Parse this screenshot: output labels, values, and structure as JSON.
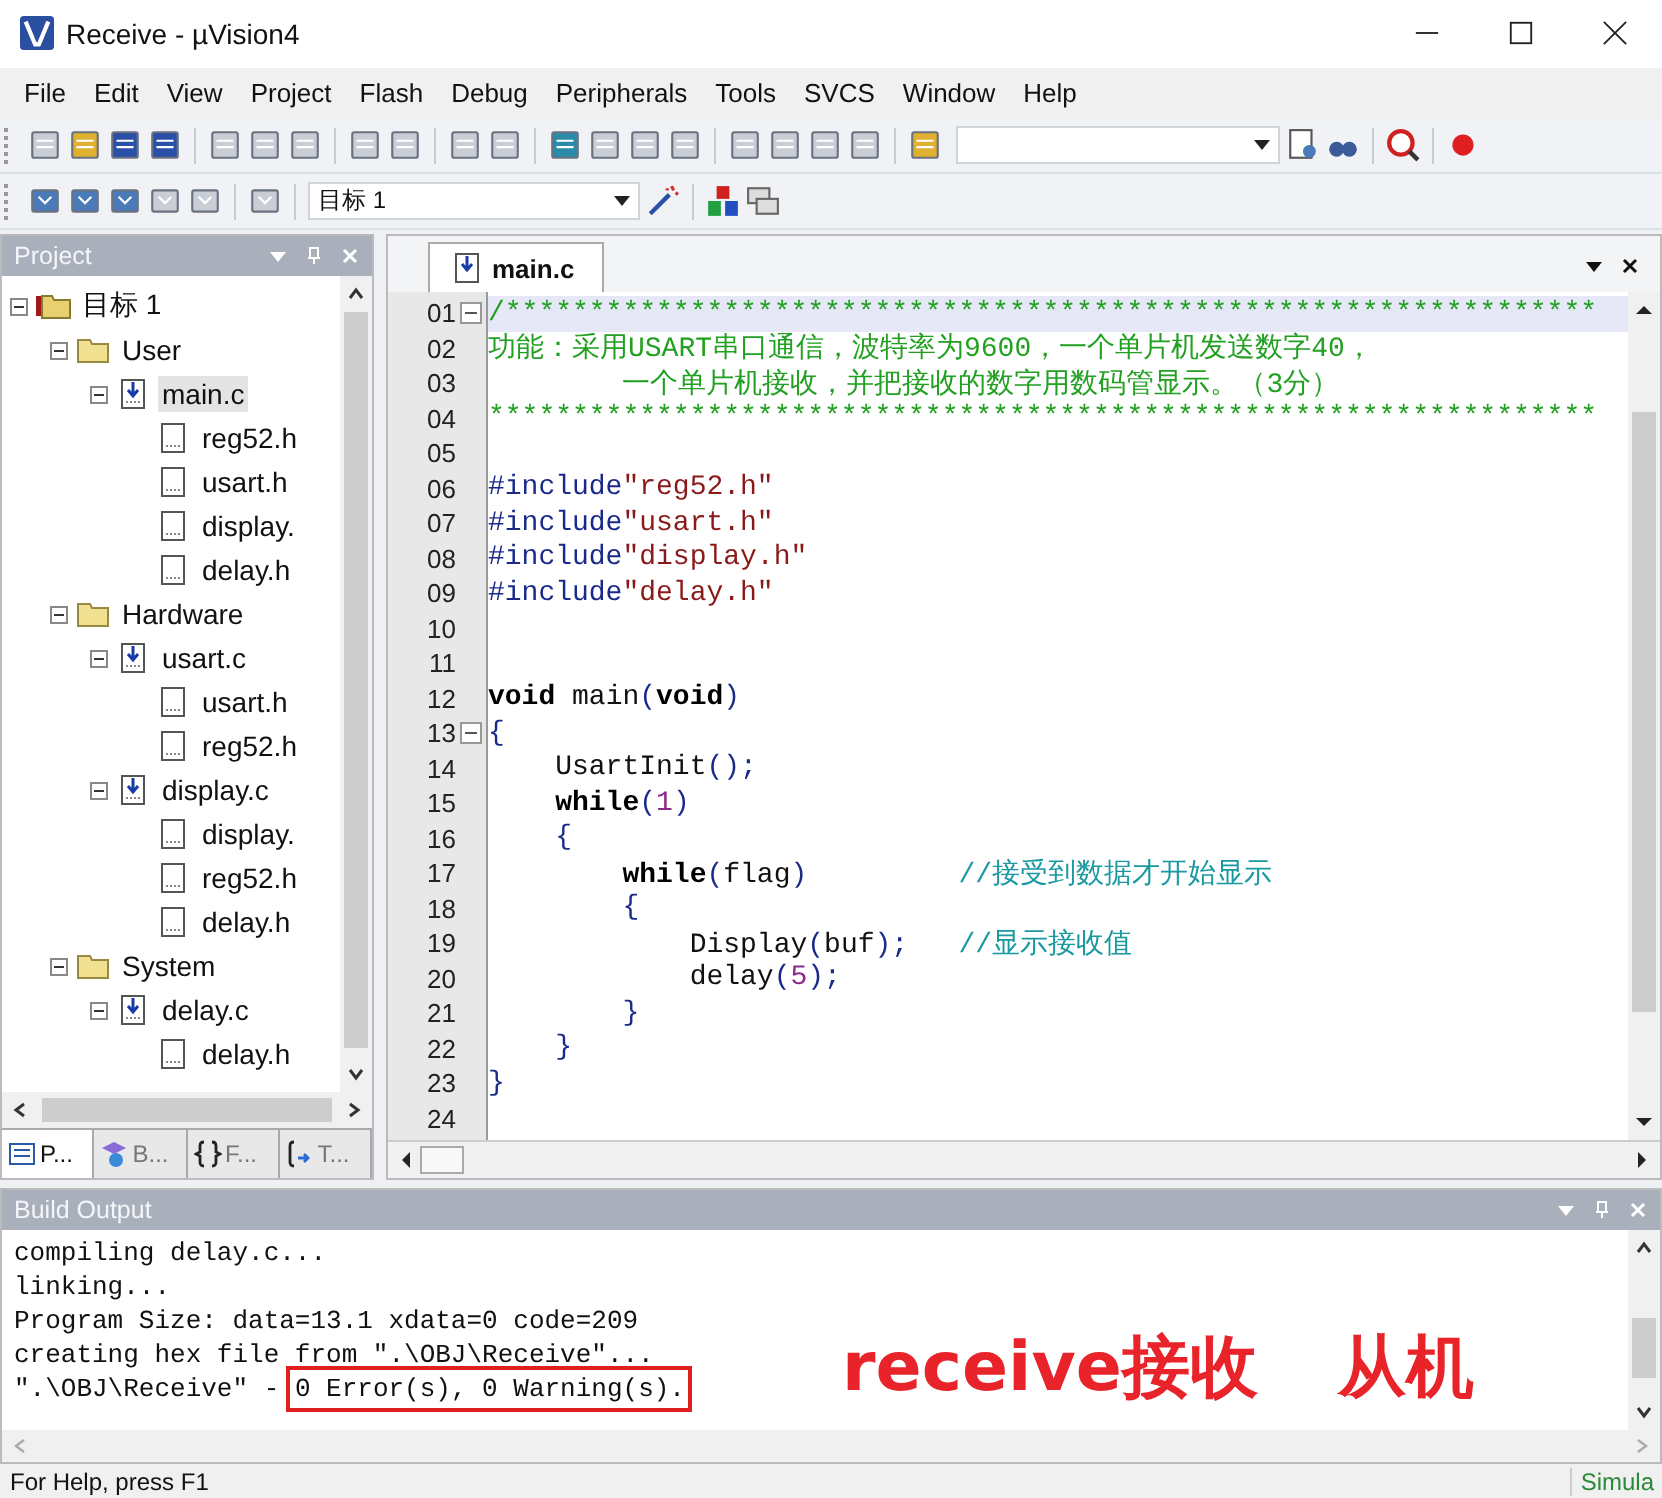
{
  "window": {
    "title": "Receive  - µVision4"
  },
  "menu": [
    "File",
    "Edit",
    "View",
    "Project",
    "Flash",
    "Debug",
    "Peripherals",
    "Tools",
    "SVCS",
    "Window",
    "Help"
  ],
  "toolbar": {
    "target": "目标 1"
  },
  "project": {
    "title": "Project",
    "tree": [
      {
        "label": "目标 1",
        "kind": "target",
        "expanded": true,
        "selected": false,
        "children": [
          {
            "label": "User",
            "kind": "folder",
            "expanded": true,
            "selected": false,
            "children": [
              {
                "label": "main.c",
                "kind": "cfile",
                "expanded": true,
                "selected": true,
                "children": [
                  {
                    "label": "reg52.h",
                    "kind": "hfile",
                    "selected": false
                  },
                  {
                    "label": "usart.h",
                    "kind": "hfile",
                    "selected": false
                  },
                  {
                    "label": "display.",
                    "kind": "hfile",
                    "selected": false
                  },
                  {
                    "label": "delay.h",
                    "kind": "hfile",
                    "selected": false
                  }
                ]
              }
            ]
          },
          {
            "label": "Hardware",
            "kind": "folder",
            "expanded": true,
            "selected": false,
            "children": [
              {
                "label": "usart.c",
                "kind": "cfile",
                "expanded": true,
                "selected": false,
                "children": [
                  {
                    "label": "usart.h",
                    "kind": "hfile",
                    "selected": false
                  },
                  {
                    "label": "reg52.h",
                    "kind": "hfile",
                    "selected": false
                  }
                ]
              },
              {
                "label": "display.c",
                "kind": "cfile",
                "expanded": true,
                "selected": false,
                "children": [
                  {
                    "label": "display.",
                    "kind": "hfile",
                    "selected": false
                  },
                  {
                    "label": "reg52.h",
                    "kind": "hfile",
                    "selected": false
                  },
                  {
                    "label": "delay.h",
                    "kind": "hfile",
                    "selected": false
                  }
                ]
              }
            ]
          },
          {
            "label": "System",
            "kind": "folder",
            "expanded": true,
            "selected": false,
            "children": [
              {
                "label": "delay.c",
                "kind": "cfile",
                "expanded": true,
                "selected": false,
                "children": [
                  {
                    "label": "delay.h",
                    "kind": "hfile",
                    "selected": false
                  }
                ]
              }
            ]
          }
        ]
      }
    ],
    "tabs": [
      {
        "label": "P...",
        "kind": "project",
        "selected": true
      },
      {
        "label": "B...",
        "kind": "books",
        "selected": false
      },
      {
        "label": "F...",
        "kind": "functions",
        "selected": false
      },
      {
        "label": "T...",
        "kind": "templates",
        "selected": false
      }
    ]
  },
  "editor": {
    "tab": {
      "label": "main.c",
      "selected": true
    },
    "lines": [
      {
        "number": "01",
        "fold": true,
        "current": true,
        "tokens": [
          {
            "kind": "block_comment",
            "text": "/*****************************************************************"
          }
        ]
      },
      {
        "number": "02",
        "fold": false,
        "current": false,
        "tokens": [
          {
            "kind": "block_comment",
            "text": "功能：采用USART串口通信，波特率为9600，一个单片机发送数字40，"
          }
        ]
      },
      {
        "number": "03",
        "fold": false,
        "current": false,
        "tokens": [
          {
            "kind": "block_comment",
            "text": "        一个单片机接收，并把接收的数字用数码管显示。（3分）"
          }
        ]
      },
      {
        "number": "04",
        "fold": false,
        "current": false,
        "tokens": [
          {
            "kind": "block_comment",
            "text": "******************************************************************"
          }
        ]
      },
      {
        "number": "05",
        "fold": false,
        "current": false
      },
      {
        "number": "06",
        "fold": false,
        "current": false,
        "tokens": [
          {
            "kind": "pp",
            "text": "#include"
          },
          {
            "kind": "str",
            "text": "\"reg52.h\""
          }
        ]
      },
      {
        "number": "07",
        "fold": false,
        "current": false,
        "tokens": [
          {
            "kind": "pp",
            "text": "#include"
          },
          {
            "kind": "str",
            "text": "\"usart.h\""
          }
        ]
      },
      {
        "number": "08",
        "fold": false,
        "current": false,
        "tokens": [
          {
            "kind": "pp",
            "text": "#include"
          },
          {
            "kind": "str",
            "text": "\"display.h\""
          }
        ]
      },
      {
        "number": "09",
        "fold": false,
        "current": false,
        "tokens": [
          {
            "kind": "pp",
            "text": "#include"
          },
          {
            "kind": "str",
            "text": "\"delay.h\""
          }
        ]
      },
      {
        "number": "10",
        "fold": false,
        "current": false
      },
      {
        "number": "11",
        "fold": false,
        "current": false
      },
      {
        "number": "12",
        "fold": false,
        "current": false,
        "tokens": [
          {
            "kind": "kw",
            "text": "void"
          },
          {
            "kind": "plain",
            "text": " main"
          },
          {
            "kind": "punc",
            "text": "("
          },
          {
            "kind": "kw",
            "text": "void"
          },
          {
            "kind": "punc",
            "text": ")"
          }
        ]
      },
      {
        "number": "13",
        "fold": true,
        "current": false,
        "tokens": [
          {
            "kind": "punc",
            "text": "{"
          }
        ]
      },
      {
        "number": "14",
        "fold": false,
        "current": false,
        "tokens": [
          {
            "kind": "plain",
            "text": "    UsartInit"
          },
          {
            "kind": "punc",
            "text": "();"
          }
        ]
      },
      {
        "number": "15",
        "fold": false,
        "current": false,
        "tokens": [
          {
            "kind": "kw",
            "text": "    while"
          },
          {
            "kind": "punc",
            "text": "("
          },
          {
            "kind": "num",
            "text": "1"
          },
          {
            "kind": "punc",
            "text": ")"
          }
        ]
      },
      {
        "number": "16",
        "fold": false,
        "current": false,
        "tokens": [
          {
            "kind": "punc",
            "text": "    {"
          }
        ]
      },
      {
        "number": "17",
        "fold": false,
        "current": false,
        "tokens": [
          {
            "kind": "kw",
            "text": "        while"
          },
          {
            "kind": "punc",
            "text": "("
          },
          {
            "kind": "plain",
            "text": "flag"
          },
          {
            "kind": "punc",
            "text": ")         "
          },
          {
            "kind": "line_comment",
            "text": "//接受到数据才开始显示"
          }
        ]
      },
      {
        "number": "18",
        "fold": false,
        "current": false,
        "tokens": [
          {
            "kind": "punc",
            "text": "        {"
          }
        ]
      },
      {
        "number": "19",
        "fold": false,
        "current": false,
        "tokens": [
          {
            "kind": "plain",
            "text": "            Display"
          },
          {
            "kind": "punc",
            "text": "("
          },
          {
            "kind": "plain",
            "text": "buf"
          },
          {
            "kind": "punc",
            "text": ");   "
          },
          {
            "kind": "line_comment",
            "text": "//显示接收值"
          }
        ]
      },
      {
        "number": "20",
        "fold": false,
        "current": false,
        "tokens": [
          {
            "kind": "plain",
            "text": "            delay"
          },
          {
            "kind": "punc",
            "text": "("
          },
          {
            "kind": "num",
            "text": "5"
          },
          {
            "kind": "punc",
            "text": ");"
          }
        ]
      },
      {
        "number": "21",
        "fold": false,
        "current": false,
        "tokens": [
          {
            "kind": "punc",
            "text": "        }"
          }
        ]
      },
      {
        "number": "22",
        "fold": false,
        "current": false,
        "tokens": [
          {
            "kind": "punc",
            "text": "    }"
          }
        ]
      },
      {
        "number": "23",
        "fold": false,
        "current": false,
        "tokens": [
          {
            "kind": "punc",
            "text": "}"
          }
        ]
      },
      {
        "number": "24",
        "fold": false,
        "current": false
      }
    ]
  },
  "build_output": {
    "title": "Build Output",
    "lines": [
      [
        {
          "text": "compiling delay.c...",
          "boxed": false
        }
      ],
      [
        {
          "text": "linking...",
          "boxed": false
        }
      ],
      [
        {
          "text": "Program Size: data=13.1 xdata=0 code=209",
          "boxed": false
        }
      ],
      [
        {
          "text": "creating hex file from \".\\OBJ\\Receive\"...",
          "boxed": false
        }
      ],
      [
        {
          "text": "\".\\OBJ\\Receive\" - ",
          "boxed": false
        },
        {
          "text": "0 Error(s), 0 Warning(s).",
          "boxed": true
        }
      ]
    ],
    "annotation": [
      "receive接收",
      "从机"
    ]
  },
  "status_bar": {
    "help": "For Help, press F1",
    "mode": "Simula"
  }
}
